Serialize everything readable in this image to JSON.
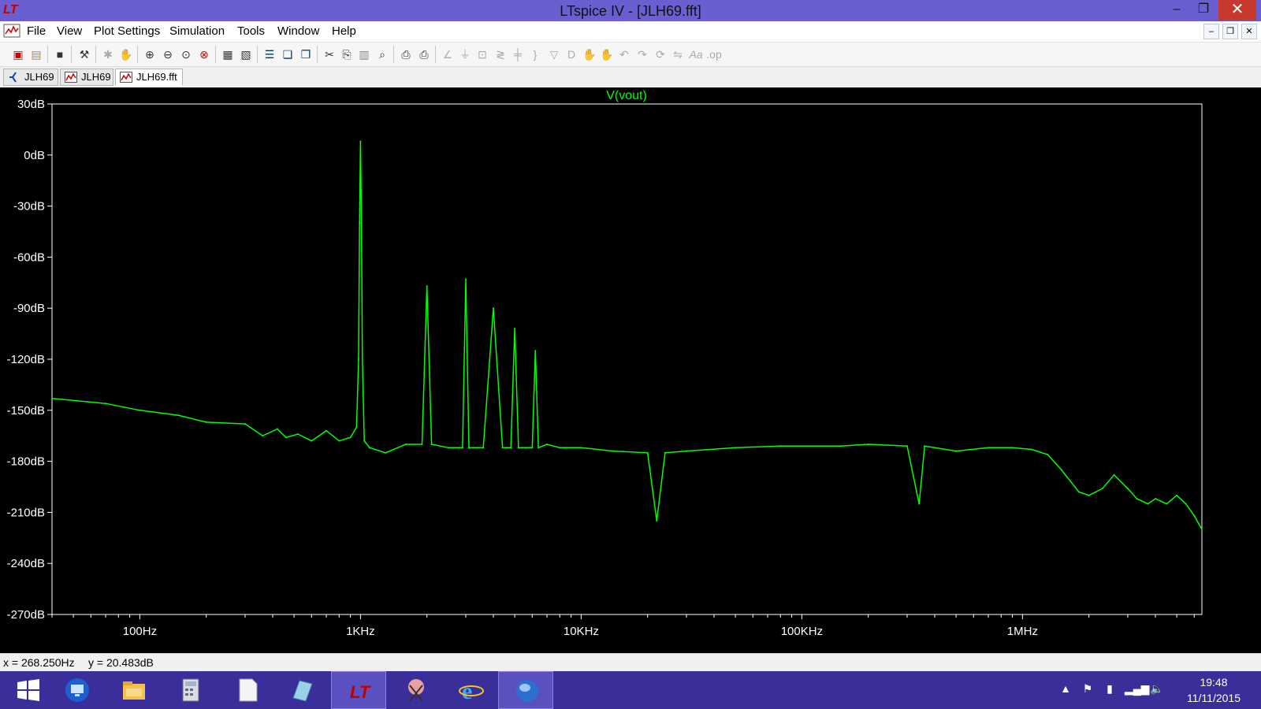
{
  "window": {
    "title": "LTspice IV - [JLH69.fft]",
    "app_icon": "ltspice-logo-icon",
    "minimize_glyph": "–",
    "maximize_glyph": "❐",
    "close_glyph": "✕"
  },
  "menu": {
    "items": [
      "File",
      "View",
      "Plot Settings",
      "Simulation",
      "Tools",
      "Window",
      "Help"
    ],
    "mdi_minimize_glyph": "–",
    "mdi_restore_glyph": "❐",
    "mdi_close_glyph": "✕"
  },
  "toolbar": {
    "icons": [
      "new-schematic-icon",
      "open-icon",
      "save-icon",
      "control-panel-icon",
      "run-icon",
      "halt-icon",
      "zoom-in-icon",
      "zoom-out-icon",
      "zoom-fit-icon",
      "zoom-cancel-icon",
      "autorange-icon",
      "annotate-icon",
      "tile-horizontal-icon",
      "cascade-icon",
      "close-all-icon",
      "cut-icon",
      "copy-icon",
      "paste-icon",
      "find-icon",
      "print-setup-icon",
      "print-icon",
      "wire-icon",
      "ground-icon",
      "label-icon",
      "resistor-icon",
      "capacitor-icon",
      "inductor-icon",
      "diode-icon",
      "component-icon",
      "move-icon",
      "drag-icon",
      "undo-icon",
      "redo-icon",
      "rotate-icon",
      "mirror-icon",
      "text-icon",
      "spice-directive-icon"
    ]
  },
  "tabs": [
    {
      "label": "JLH69",
      "icon": "schematic-icon",
      "active": false
    },
    {
      "label": "JLH69",
      "icon": "waveform-icon",
      "active": false
    },
    {
      "label": "JLH69.fft",
      "icon": "waveform-icon",
      "active": true
    }
  ],
  "chart_data": {
    "type": "line",
    "title": "V(vout)",
    "x_scale": "log",
    "xlim": [
      40,
      6500000
    ],
    "ylim": [
      -270,
      30
    ],
    "x_ticks": [
      {
        "value": 100,
        "label": "100Hz"
      },
      {
        "value": 1000,
        "label": "1KHz"
      },
      {
        "value": 10000,
        "label": "10KHz"
      },
      {
        "value": 100000,
        "label": "100KHz"
      },
      {
        "value": 1000000,
        "label": "1MHz"
      }
    ],
    "y_ticks": [
      {
        "value": 30,
        "label": "30dB"
      },
      {
        "value": 0,
        "label": "0dB"
      },
      {
        "value": -30,
        "label": "-30dB"
      },
      {
        "value": -60,
        "label": "-60dB"
      },
      {
        "value": -90,
        "label": "-90dB"
      },
      {
        "value": -120,
        "label": "-120dB"
      },
      {
        "value": -150,
        "label": "-150dB"
      },
      {
        "value": -180,
        "label": "-180dB"
      },
      {
        "value": -210,
        "label": "-210dB"
      },
      {
        "value": -240,
        "label": "-240dB"
      },
      {
        "value": -270,
        "label": "-270dB"
      }
    ],
    "series": [
      {
        "name": "V(vout)",
        "color": "#00ff00",
        "x": [
          40,
          70,
          100,
          150,
          200,
          300,
          360,
          420,
          460,
          520,
          600,
          700,
          800,
          900,
          960,
          980,
          990,
          1000,
          1010,
          1020,
          1040,
          1100,
          1300,
          1600,
          1900,
          2000,
          2100,
          2500,
          2900,
          3000,
          3100,
          3600,
          4000,
          4400,
          4800,
          5000,
          5200,
          5600,
          6000,
          6200,
          6400,
          7000,
          8000,
          10000,
          14000,
          20000,
          22000,
          24000,
          30000,
          50000,
          80000,
          150000,
          200000,
          300000,
          340000,
          360000,
          400000,
          500000,
          700000,
          900000,
          1100000,
          1300000,
          1500000,
          1800000,
          2000000,
          2300000,
          2600000,
          3000000,
          3300000,
          3700000,
          4000000,
          4500000,
          5000000,
          5500000,
          6000000,
          6500000
        ],
        "y": [
          -143,
          -146,
          -150,
          -153,
          -157,
          -158,
          -165,
          -161,
          -166,
          -164,
          -168,
          -162,
          -168,
          -166,
          -160,
          -120,
          -40,
          8,
          -40,
          -120,
          -168,
          -172,
          -175,
          -170,
          -170,
          -77,
          -170,
          -172,
          -172,
          -73,
          -172,
          -172,
          -90,
          -172,
          -172,
          -102,
          -172,
          -172,
          -172,
          -115,
          -172,
          -170,
          -172,
          -172,
          -174,
          -175,
          -215,
          -175,
          -174,
          -172,
          -171,
          -171,
          -170,
          -171,
          -205,
          -171,
          -172,
          -174,
          -172,
          -172,
          -173,
          -176,
          -185,
          -198,
          -200,
          -196,
          -188,
          -196,
          -202,
          -205,
          -202,
          -205,
          -200,
          -205,
          -212,
          -220
        ]
      }
    ]
  },
  "status": {
    "x_readout": "x = 268.250Hz",
    "y_readout": "y = 20.483dB"
  },
  "taskbar": {
    "apps": [
      "start-icon",
      "remote-desktop-icon",
      "file-explorer-icon",
      "calculator-icon",
      "notepad-icon",
      "paint-icon",
      "ltspice-icon",
      "snipping-tool-icon",
      "internet-explorer-icon",
      "globe-icon"
    ],
    "active_app": "ltspice-icon",
    "clock_time": "19:48",
    "clock_date": "11/11/2015",
    "tray_icons": [
      "tray-arrow-icon",
      "flag-icon",
      "battery-icon",
      "network-icon",
      "volume-icon"
    ]
  }
}
